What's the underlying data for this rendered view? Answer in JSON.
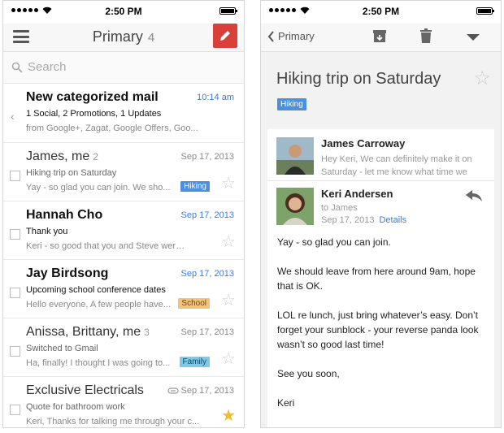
{
  "status_bar": {
    "time": "2:50 PM"
  },
  "inbox": {
    "title": "Primary",
    "count": "4",
    "search_placeholder": "Search",
    "items": [
      {
        "sender": "New categorized mail",
        "count": "",
        "date": "10:14 am",
        "subject": "1 Social, 2 Promotions, 1 Updates",
        "preview": "from Google+, Zagat, Google Offers, Goo...",
        "tag": "",
        "unread": true,
        "starred": false,
        "attachment": false
      },
      {
        "sender": "James, me",
        "count": "2",
        "date": "Sep 17, 2013",
        "subject": "Hiking trip on Saturday",
        "preview": "Yay - so glad you can join. We sho...",
        "tag": "Hiking",
        "unread": false,
        "starred": false,
        "attachment": false
      },
      {
        "sender": "Hannah Cho",
        "count": "",
        "date": "Sep 17, 2013",
        "subject": "Thank you",
        "preview": "Keri - so good that you and Steve were ab...",
        "tag": "",
        "unread": true,
        "starred": false,
        "attachment": false
      },
      {
        "sender": "Jay Birdsong",
        "count": "",
        "date": "Sep 17, 2013",
        "subject": "Upcoming school conference dates",
        "preview": "Hello everyone, A few people have...",
        "tag": "School",
        "unread": true,
        "starred": false,
        "attachment": false
      },
      {
        "sender": "Anissa, Brittany, me",
        "count": "3",
        "date": "Sep 17, 2013",
        "subject": "Switched to Gmail",
        "preview": "Ha, finally! I thought I was going to...",
        "tag": "Family",
        "unread": false,
        "starred": false,
        "attachment": false
      },
      {
        "sender": "Exclusive Electricals",
        "count": "",
        "date": "Sep 17, 2013",
        "subject": "Quote for bathroom work",
        "preview": "Keri, Thanks for talking me through your c...",
        "tag": "",
        "unread": false,
        "starred": true,
        "attachment": true
      }
    ]
  },
  "colors": {
    "compose": "#d9403a",
    "blue": "#3b7ddd",
    "tag_hiking": "#4a8fe0",
    "tag_school": "#f3c27a",
    "tag_family": "#7ec8e8",
    "star": "#f3bc2a"
  },
  "thread": {
    "back_label": "Primary",
    "title": "Hiking trip on Saturday",
    "tag": "Hiking",
    "messages": [
      {
        "sender": "James Carroway",
        "snippet": "Hey Keri, We can definitely make it on Saturday - let me know what time we"
      },
      {
        "sender": "Keri Andersen",
        "to": "to James",
        "date": "Sep 17, 2013",
        "details": "Details",
        "body": [
          "Yay - so glad you can join.",
          "We should leave from here around 9am, hope that is OK.",
          "LOL re lunch, just bring whatever’s easy. Don’t forget your sunblock - your reverse panda look wasn’t so good last time!",
          "See you soon,",
          "Keri"
        ]
      }
    ]
  }
}
